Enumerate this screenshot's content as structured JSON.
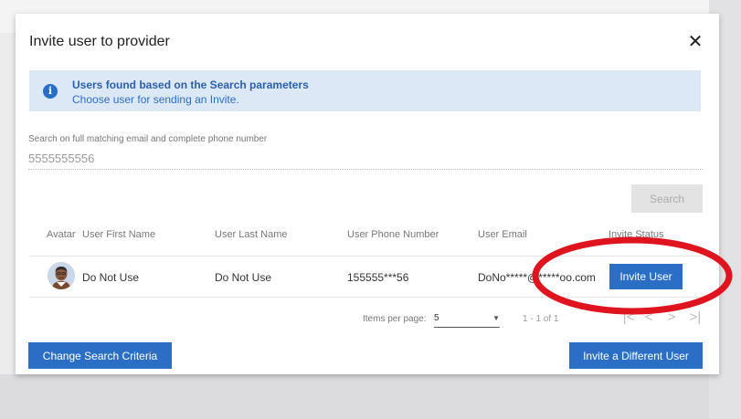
{
  "modal": {
    "title": "Invite user to provider",
    "close_icon": "close-icon"
  },
  "info": {
    "icon": "info-icon",
    "icon_glyph": "i",
    "title": "Users found based on the Search parameters",
    "subtitle": "Choose user for sending an Invite."
  },
  "search": {
    "label": "Search on full matching email and complete phone number",
    "value": "5555555556",
    "button_label": "Search"
  },
  "table": {
    "headers": [
      "Avatar",
      "User First Name",
      "User Last Name",
      "User Phone Number",
      "User Email",
      "Invite Status"
    ],
    "rows": [
      {
        "first_name": "Do Not Use",
        "last_name": "Do Not Use",
        "phone": "155555***56",
        "email": "DoNo*****@*****oo.com",
        "action_label": "Invite User"
      }
    ]
  },
  "pagination": {
    "items_per_page_label": "Items per page:",
    "items_per_page_value": "5",
    "range": "1 - 1 of 1",
    "first": "|<",
    "prev": "<",
    "next": ">",
    "last": ">|"
  },
  "footer": {
    "change_label": "Change Search Criteria",
    "different_label": "Invite a Different User"
  },
  "colors": {
    "primary": "#2a6ec6",
    "info_bg": "#dde8f7",
    "annotation": "#e0141e"
  }
}
